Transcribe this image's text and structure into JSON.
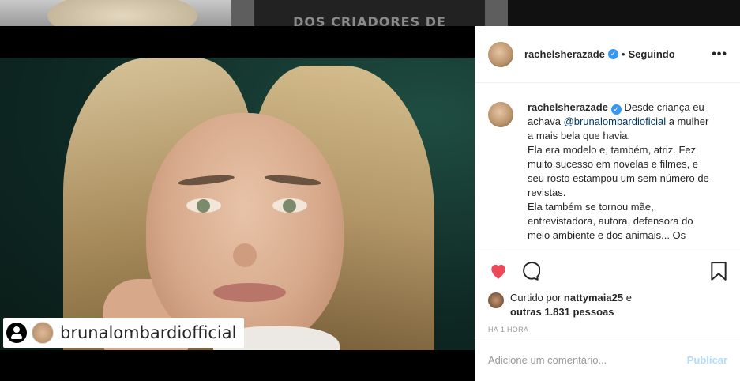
{
  "background": {
    "tile2_text": "DOS CRIADORES DE"
  },
  "media": {
    "tag_username": "brunalombardiofficial"
  },
  "header": {
    "username": "rachelsherazade",
    "separator": "•",
    "follow_status": "Seguindo",
    "more_label": "•••"
  },
  "caption": {
    "username": "rachelsherazade",
    "line1_start": "Desde criança eu achava ",
    "mention": "@brunalombardioficial",
    "line1_end": " a mulher a mais bela que havia.",
    "line2": "Ela era modelo e, também, atriz. Fez muito sucesso em novelas e filmes, e seu rosto estampou um sem número de revistas.",
    "line3": "Ela também se tornou mãe, entrevistadora, autora, defensora do meio ambiente e dos animais... Os"
  },
  "likes": {
    "prefix": "Curtido por ",
    "liker": "nattymaia25",
    "conj": " e",
    "others": "outras 1.831 pessoas"
  },
  "time": "HÁ 1 HORA",
  "comment": {
    "placeholder": "Adicione um comentário...",
    "publish_label": "Publicar"
  },
  "colors": {
    "verified": "#3897f0",
    "heart": "#ed4956",
    "publish_disabled": "#b3dbff"
  },
  "icons": [
    "heart-icon",
    "comment-icon",
    "bookmark-icon",
    "verified-icon",
    "more-icon",
    "tag-person-icon"
  ]
}
